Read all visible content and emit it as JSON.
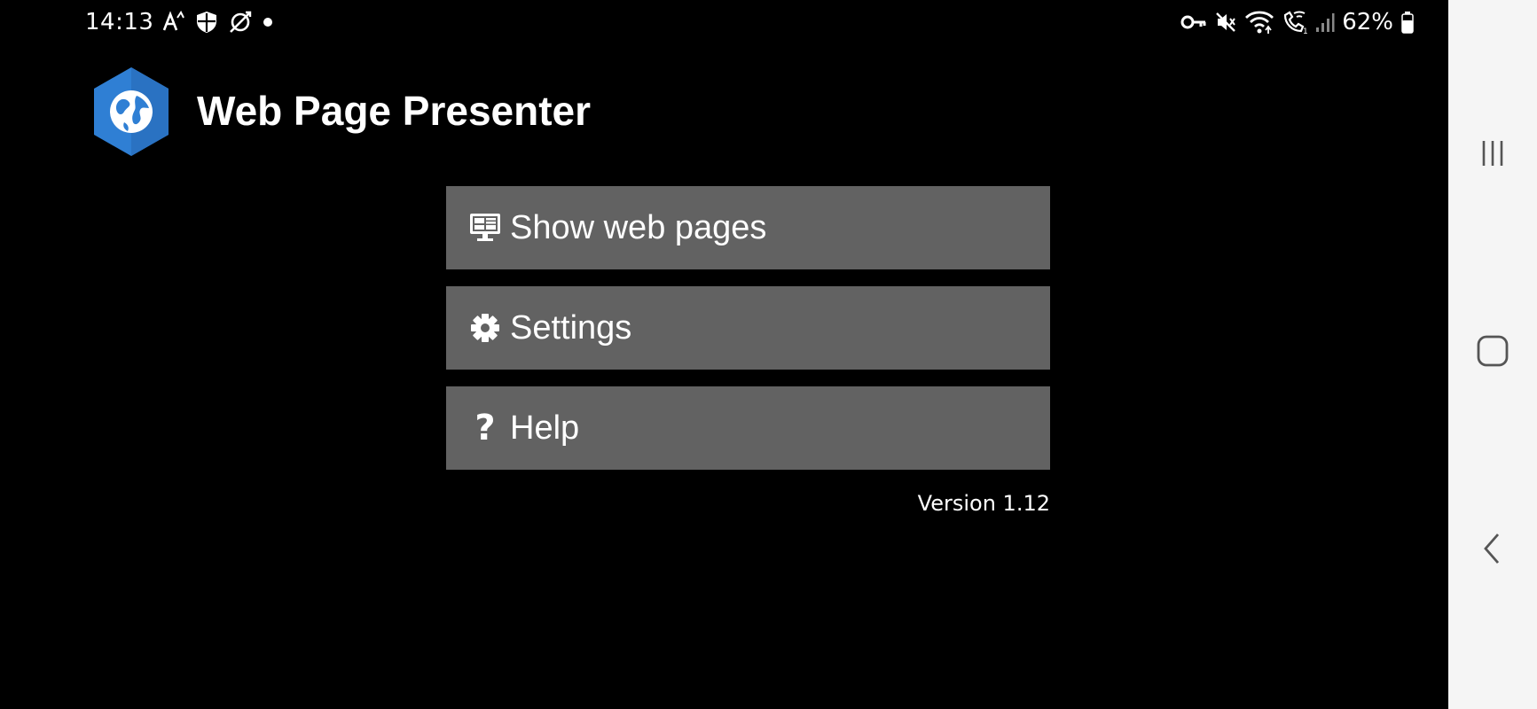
{
  "status_bar": {
    "time": "14:13",
    "battery_percent": "62%",
    "left_icons": [
      "font-size-icon",
      "shield-icon",
      "sync-off-icon",
      "notification-dot-icon"
    ],
    "right_icons": [
      "key-icon",
      "mute-icon",
      "wifi-icon",
      "wifi-calling-icon",
      "signal-icon",
      "battery-icon"
    ]
  },
  "header": {
    "title": "Web Page Presenter",
    "logo_icon": "globe-hexagon-icon"
  },
  "menu": {
    "items": [
      {
        "label": "Show web pages",
        "icon": "monitor-icon"
      },
      {
        "label": "Settings",
        "icon": "gear-icon"
      },
      {
        "label": "Help",
        "icon": "question-icon"
      }
    ]
  },
  "version": "Version 1.12",
  "navigation_bar": {
    "buttons": [
      "recents-icon",
      "home-icon",
      "back-icon"
    ]
  },
  "colors": {
    "background": "#000000",
    "button_bg": "#626262",
    "logo_blue": "#2f7fd4",
    "navbar_bg": "#f5f5f5"
  }
}
